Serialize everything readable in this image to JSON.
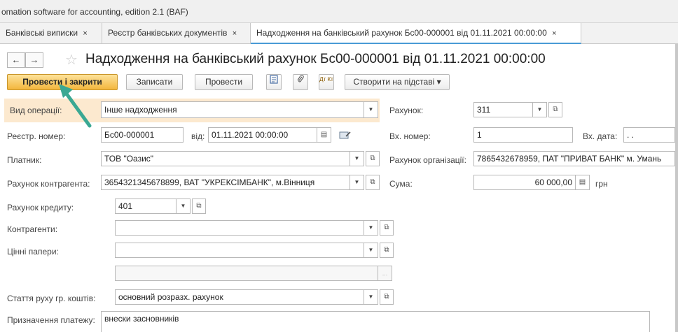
{
  "window": {
    "title": "omation software for accounting, edition 2.1  (BAF)"
  },
  "tabs": [
    {
      "label": "Банківські виписки",
      "close": "×"
    },
    {
      "label": "Реєстр банківських документів",
      "close": "×"
    },
    {
      "label": "Надходження на банківський рахунок Бс00-000001 від 01.11.2021 00:00:00",
      "close": "×"
    }
  ],
  "header": {
    "back": "←",
    "forward": "→",
    "star": "☆",
    "title": "Надходження на банківський рахунок Бс00-000001 від 01.11.2021 00:00:00"
  },
  "toolbar": {
    "post_close": "Провести і закрити",
    "save": "Записати",
    "post": "Провести",
    "dtkt": "Дт Кт",
    "create_based": "Створити на підставі ▾"
  },
  "form": {
    "op_type": {
      "label": "Вид операції:",
      "value": "Інше надходження"
    },
    "account": {
      "label": "Рахунок:",
      "value": "311"
    },
    "reg_no": {
      "label": "Реєстр. номер:",
      "value": "Бс00-000001"
    },
    "date": {
      "label": "від:",
      "value": "01.11.2021 00:00:00"
    },
    "in_no": {
      "label": "Вх. номер:",
      "value": "1"
    },
    "in_date": {
      "label": "Вх. дата:",
      "value": " .  . "
    },
    "payer": {
      "label": "Платник:",
      "value": "ТОВ \"Оазис\""
    },
    "org_account": {
      "label": "Рахунок організації:",
      "value": "7865432678959, ПАТ \"ПРИВАТ БАНК\" м. Умань"
    },
    "contractor_account": {
      "label": "Рахунок контрагента:",
      "value": "3654321345678899, ВАТ \"УКРЕКСІМБАНК\", м.Вінниця"
    },
    "amount": {
      "label": "Сума:",
      "value": "60 000,00",
      "currency": "грн"
    },
    "credit_account": {
      "label": "Рахунок кредиту:",
      "value": "401"
    },
    "contractors": {
      "label": "Контрагенти:",
      "value": ""
    },
    "securities": {
      "label": "Цінні папери:",
      "value": ""
    },
    "extra": {
      "value": "",
      "dots": "..."
    },
    "cashflow": {
      "label": "Стаття руху гр. коштів:",
      "value": "основний розразх. рахунок"
    },
    "purpose": {
      "label": "Призначення платежу:",
      "value": "внески засновників"
    }
  },
  "colors": {
    "accent_arrow": "#3aa893",
    "primary_button": "#f3b63d",
    "active_tab_underline": "#4a9bd6"
  }
}
